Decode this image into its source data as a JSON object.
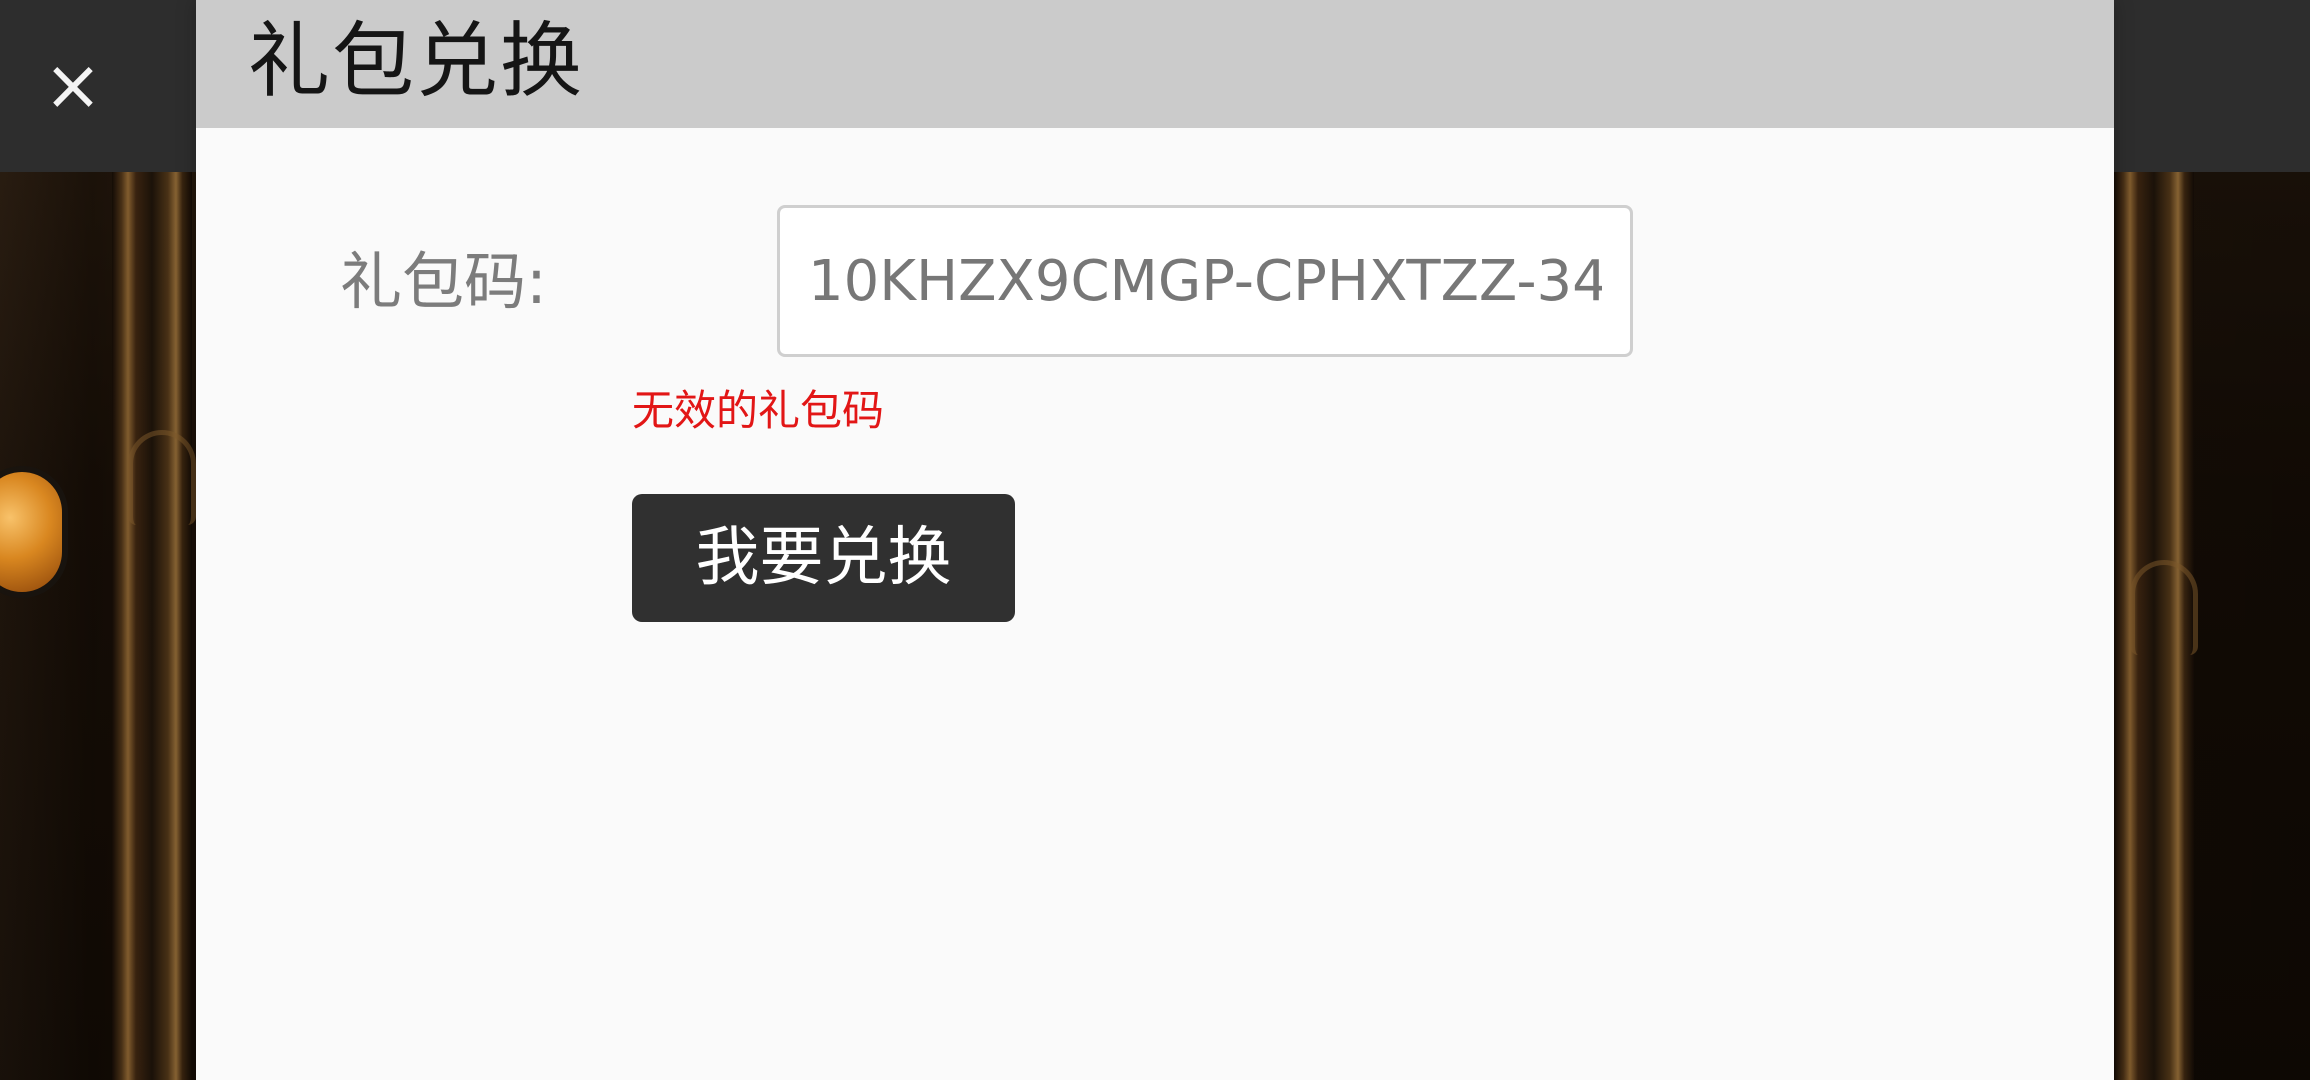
{
  "dialog": {
    "title": "礼包兑换",
    "field_label": "礼包码:",
    "gift_code_value": "10KHZX9CMGP-CPHXTZZ-34",
    "error_text": "无效的礼包码",
    "redeem_button": "我要兑换",
    "close_icon": "×"
  },
  "icons": {
    "close": "close-icon",
    "partial_avatar": "game-avatar-icon"
  },
  "colors": {
    "header_background": "#cbcbcb",
    "modal_background": "#fafafa",
    "error_text": "#e21616",
    "button_background": "#303030",
    "top_bar": "#2d2d2d"
  }
}
